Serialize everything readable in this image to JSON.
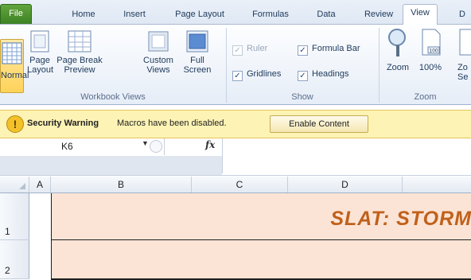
{
  "tabs": {
    "file": "File",
    "home": "Home",
    "insert": "Insert",
    "page_layout": "Page Layout",
    "formulas": "Formulas",
    "data": "Data",
    "review": "Review",
    "view": "View",
    "cutoff": "D"
  },
  "ribbon": {
    "workbook_views": {
      "label": "Workbook Views",
      "normal": "Normal",
      "page_layout": [
        "Page",
        "Layout"
      ],
      "page_break": [
        "Page Break",
        "Preview"
      ],
      "custom_views": [
        "Custom",
        "Views"
      ],
      "full_screen": [
        "Full",
        "Screen"
      ]
    },
    "show": {
      "label": "Show",
      "ruler": "Ruler",
      "formula_bar": "Formula Bar",
      "gridlines": "Gridlines",
      "headings": "Headings",
      "ruler_checked": true,
      "formula_bar_checked": true,
      "gridlines_checked": true,
      "headings_checked": true
    },
    "zoom": {
      "label": "Zoom",
      "zoom": "Zoom",
      "hundred": "100%",
      "zoom_to_sel": [
        "Zo",
        "Se"
      ]
    }
  },
  "security": {
    "title": "Security Warning",
    "message": "Macros have been disabled.",
    "button": "Enable Content"
  },
  "formula_bar": {
    "name_box": "K6",
    "fx": "fx",
    "formula": ""
  },
  "grid": {
    "columns": [
      "A",
      "B",
      "C",
      "D"
    ],
    "rows": [
      "1",
      "2"
    ],
    "title": "SLAT: STORM"
  },
  "colors": {
    "accent_file_tab": "#3c8224",
    "title_fill": "#fbe4d6",
    "title_text": "#c0611b",
    "warning_bar": "#fdf3b5"
  }
}
